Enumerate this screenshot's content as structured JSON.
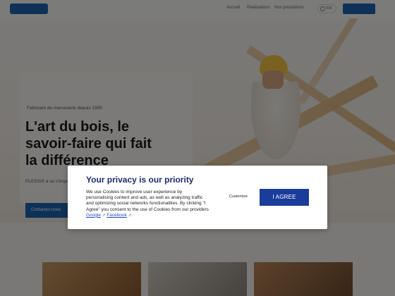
{
  "header": {
    "logo": "",
    "nav": [
      "Accueil",
      "Réalisations",
      "Nos prestations"
    ],
    "lang": "FR",
    "cta": ""
  },
  "hero": {
    "eyebrow": "Fabricant de menuiserie depuis 1995",
    "headline": [
      "L'art du bois, le",
      "savoir-faire qui fait",
      "la différence"
    ],
    "description": "PLESSIX a su s'imposer dans les travaux de menuiserie",
    "button": "Contactez-nous"
  },
  "privacy": {
    "title": "Your privacy is our priority",
    "text_main": "We use Cookies to improve user experience by personalising content and ads, as well as analyzing traffic and optimizing social networks functionalities. By clicking \"I Agree\" you consent to the use of Cookies from our providers",
    "link_google": "Google",
    "link_facebook": "Facebook",
    "ext_icon": "↗",
    "period": ".",
    "customize": "Customize",
    "agree": "I AGREE"
  },
  "colors": {
    "brand": "#1d63b0",
    "modal_title": "#1c2c6d",
    "agree_button": "#1a3d9c"
  }
}
